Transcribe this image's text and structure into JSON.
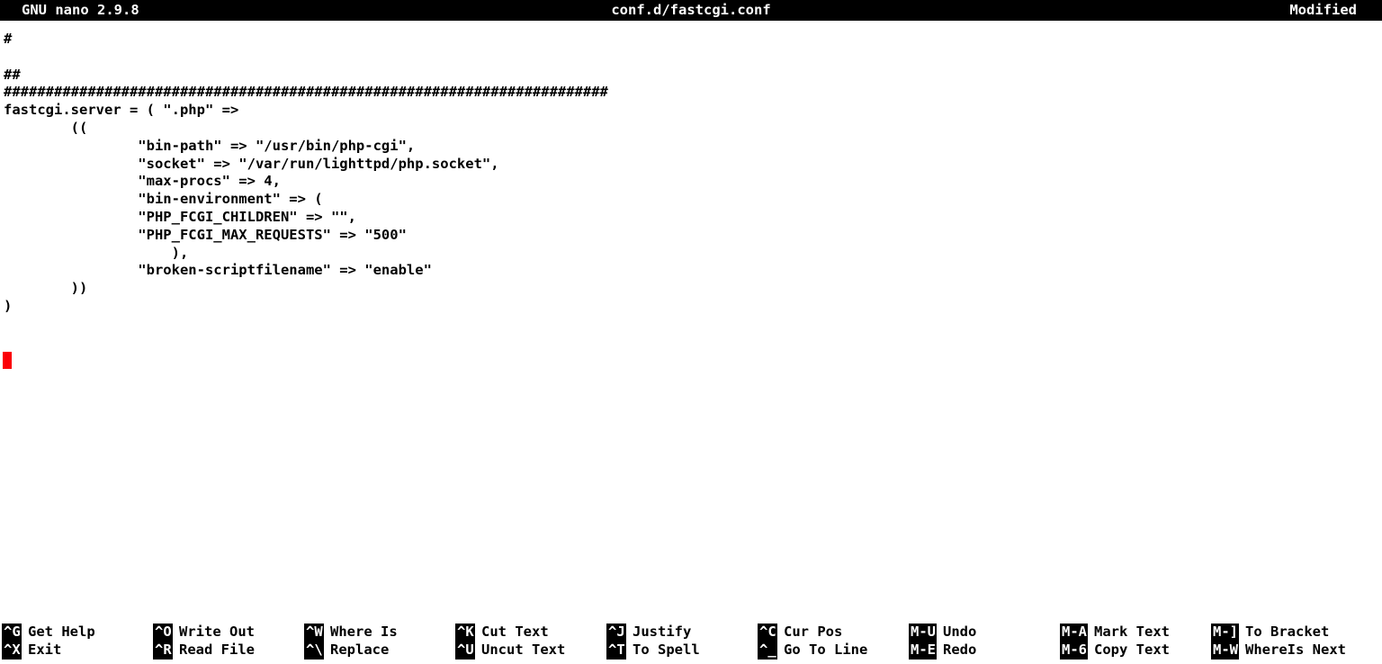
{
  "titlebar": {
    "version": "GNU nano 2.9.8",
    "filename": "conf.d/fastcgi.conf",
    "status": "Modified"
  },
  "editor": {
    "lines": [
      "#",
      "",
      "##",
      "########################################################################",
      "fastcgi.server = ( \".php\" =>",
      "        ((",
      "                \"bin-path\" => \"/usr/bin/php-cgi\",",
      "                \"socket\" => \"/var/run/lighttpd/php.socket\",",
      "                \"max-procs\" => 4,",
      "                \"bin-environment\" => (",
      "                \"PHP_FCGI_CHILDREN\" => \"\",",
      "                \"PHP_FCGI_MAX_REQUESTS\" => \"500\"",
      "                    ),",
      "                \"broken-scriptfilename\" => \"enable\"",
      "        ))",
      ")",
      ""
    ],
    "cursor_color": "#fb0007",
    "cursor_line": 16,
    "cursor_column": 0
  },
  "helpbar": {
    "columns": [
      {
        "top": {
          "key": "^G",
          "label": "Get Help"
        },
        "bottom": {
          "key": "^X",
          "label": "Exit"
        }
      },
      {
        "top": {
          "key": "^O",
          "label": "Write Out"
        },
        "bottom": {
          "key": "^R",
          "label": "Read File"
        }
      },
      {
        "top": {
          "key": "^W",
          "label": "Where Is"
        },
        "bottom": {
          "key": "^\\",
          "label": "Replace"
        }
      },
      {
        "top": {
          "key": "^K",
          "label": "Cut Text"
        },
        "bottom": {
          "key": "^U",
          "label": "Uncut Text"
        }
      },
      {
        "top": {
          "key": "^J",
          "label": "Justify"
        },
        "bottom": {
          "key": "^T",
          "label": "To Spell"
        }
      },
      {
        "top": {
          "key": "^C",
          "label": "Cur Pos"
        },
        "bottom": {
          "key": "^_",
          "label": "Go To Line"
        }
      },
      {
        "top": {
          "key": "M-U",
          "label": "Undo"
        },
        "bottom": {
          "key": "M-E",
          "label": "Redo"
        }
      },
      {
        "top": {
          "key": "M-A",
          "label": "Mark Text"
        },
        "bottom": {
          "key": "M-6",
          "label": "Copy Text"
        }
      },
      {
        "top": {
          "key": "M-]",
          "label": "To Bracket"
        },
        "bottom": {
          "key": "M-W",
          "label": "WhereIs Next"
        }
      }
    ]
  }
}
